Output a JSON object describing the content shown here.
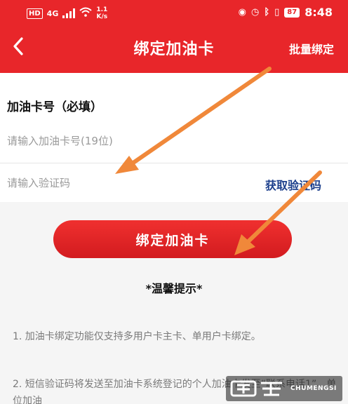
{
  "status_bar": {
    "network_badge": "HD",
    "network_type": "4G",
    "speed": "1.1",
    "speed_unit": "K/s",
    "battery": "87",
    "time": "8:48"
  },
  "nav": {
    "title": "绑定加油卡",
    "right_action": "批量绑定"
  },
  "form": {
    "card_label": "加油卡号（必填）",
    "card_placeholder": "请输入加油卡号(19位)",
    "code_placeholder": "请输入验证码",
    "get_code_label": "获取验证码"
  },
  "submit_label": "绑定加油卡",
  "tips": {
    "title": "*温馨提示*",
    "items": [
      "1. 加油卡绑定功能仅支持多用户卡主卡、单用户卡绑定。",
      "2. 短信验证码将发送至加油卡系统登记的个人加油卡发至“联系电话1”、单位加油"
    ]
  },
  "watermark": {
    "text": "CHUMENGSI"
  },
  "colors": {
    "brand_red": "#e8262a",
    "link_blue": "#1c3f8c",
    "annotation_arrow": "#f0883a"
  }
}
